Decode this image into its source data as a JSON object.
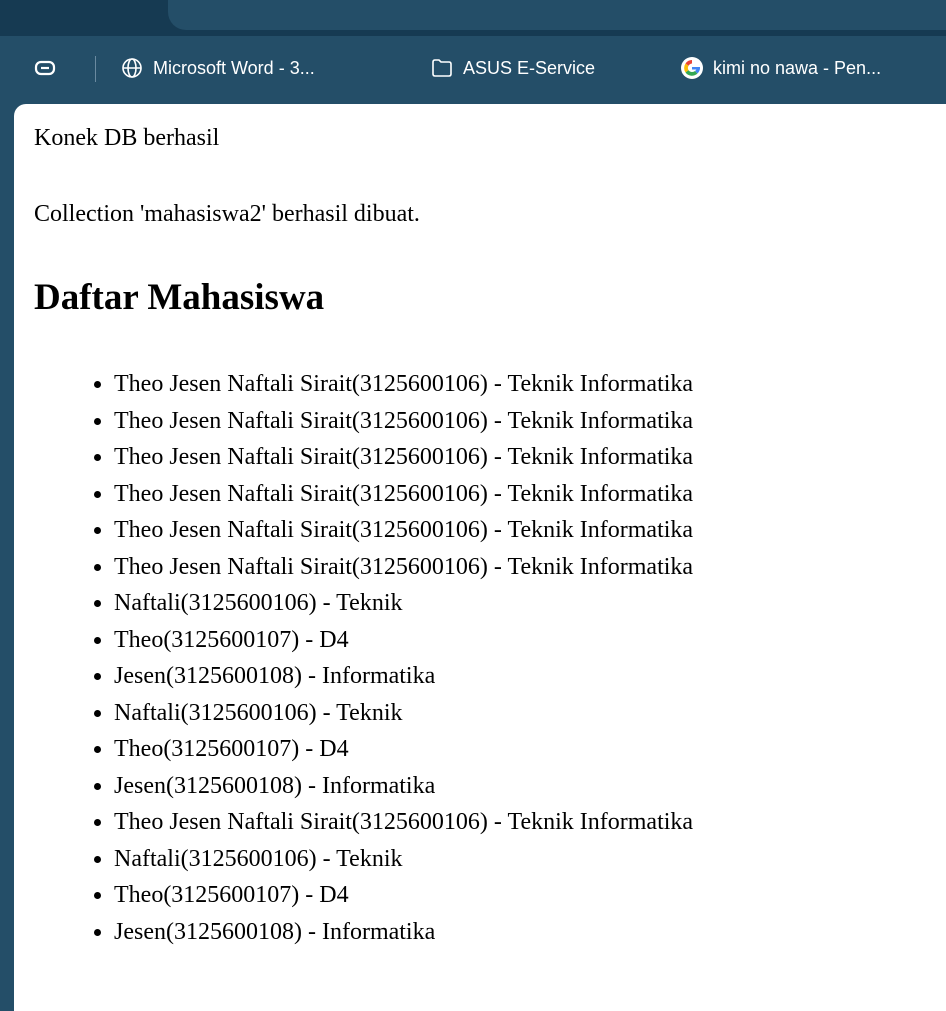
{
  "bookmarks": {
    "items": [
      {
        "label": "Microsoft Word - 3...",
        "icon": "globe-icon"
      },
      {
        "label": "ASUS E-Service",
        "icon": "folder-icon"
      },
      {
        "label": "kimi no nawa - Pen...",
        "icon": "google-icon"
      }
    ]
  },
  "page": {
    "message1": "Konek DB berhasil",
    "message2": "Collection 'mahasiswa2' berhasil dibuat.",
    "heading": "Daftar Mahasiswa",
    "students": [
      "Theo Jesen Naftali Sirait(3125600106) - Teknik Informatika",
      "Theo Jesen Naftali Sirait(3125600106) - Teknik Informatika",
      "Theo Jesen Naftali Sirait(3125600106) - Teknik Informatika",
      "Theo Jesen Naftali Sirait(3125600106) - Teknik Informatika",
      "Theo Jesen Naftali Sirait(3125600106) - Teknik Informatika",
      "Theo Jesen Naftali Sirait(3125600106) - Teknik Informatika",
      "Naftali(3125600106) - Teknik",
      "Theo(3125600107) - D4",
      "Jesen(3125600108) - Informatika",
      "Naftali(3125600106) - Teknik",
      "Theo(3125600107) - D4",
      "Jesen(3125600108) - Informatika",
      "Theo Jesen Naftali Sirait(3125600106) - Teknik Informatika",
      "Naftali(3125600106) - Teknik",
      "Theo(3125600107) - D4",
      "Jesen(3125600108) - Informatika"
    ]
  },
  "colors": {
    "chrome": "#244e68",
    "tabstrip": "#163a52",
    "content_bg": "#ffffff",
    "text": "#000000"
  }
}
